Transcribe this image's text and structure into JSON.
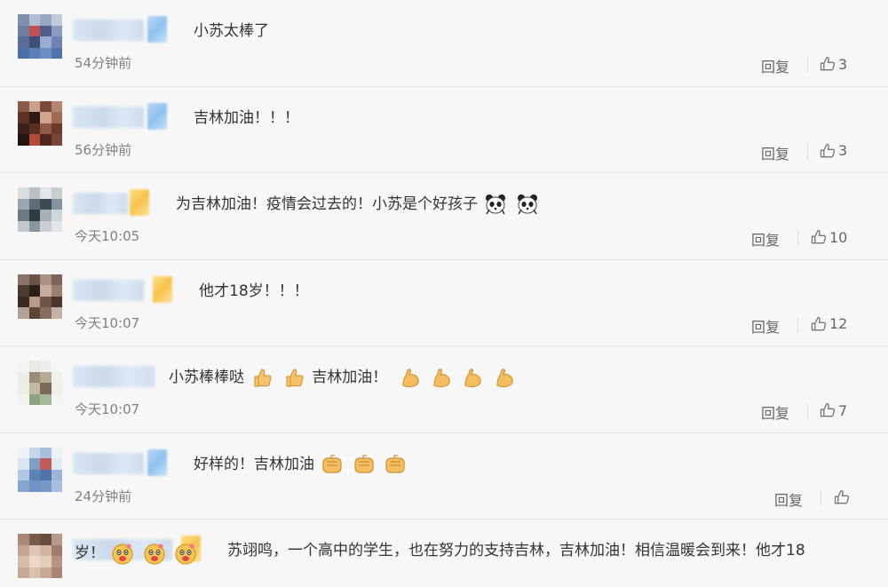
{
  "comments": [
    {
      "text": "小苏太棒了",
      "time": "54分钟前",
      "reply_label": "回复",
      "likes": "3"
    },
    {
      "text": "吉林加油！！！",
      "time": "56分钟前",
      "reply_label": "回复",
      "likes": "3"
    },
    {
      "text": "为吉林加油！疫情会过去的！小苏是个好孩子",
      "time": "今天10:05",
      "reply_label": "回复",
      "likes": "10"
    },
    {
      "text": "他才18岁！！！",
      "time": "今天10:07",
      "reply_label": "回复",
      "likes": "12"
    },
    {
      "text_a": "小苏棒棒哒",
      "text_b": "吉林加油！",
      "time": "今天10:07",
      "reply_label": "回复",
      "likes": "7"
    },
    {
      "text": "好样的！吉林加油",
      "time": "24分钟前",
      "reply_label": "回复",
      "likes": ""
    },
    {
      "text_line1": "苏翊鸣，一个高中的学生，也在努力的支持吉林，吉林加油！相信温暖会到来！他才18",
      "text_line2": "岁！"
    }
  ],
  "icons": {
    "like": "thumbs-up-icon",
    "panda": "panda-emoji-icon",
    "thumb": "thumbs-up-emoji-icon",
    "flex": "flexed-biceps-emoji-icon",
    "fist": "fist-emoji-icon",
    "doge": "doge-emoji-icon"
  },
  "colors": {
    "background": "#f7f7f7",
    "text": "#333333",
    "meta": "#808080",
    "divider": "#e6e6e6"
  }
}
